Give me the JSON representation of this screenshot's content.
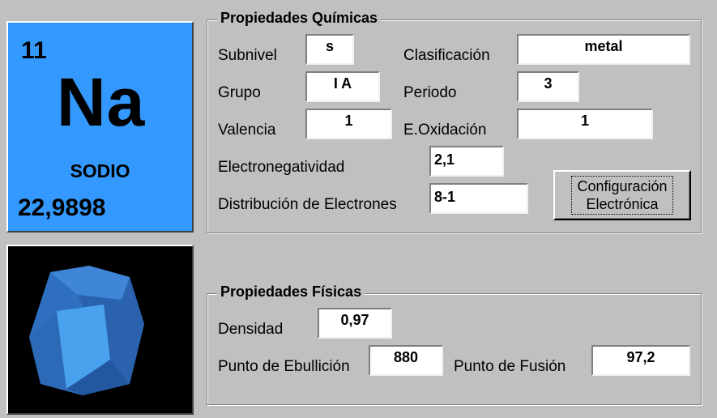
{
  "element": {
    "atomic_number": "11",
    "symbol": "Na",
    "name": "SODIO",
    "atomic_mass": "22,9898",
    "card_color": "#3399ff"
  },
  "image": {
    "name": "crystal-image",
    "color": "#3399ff"
  },
  "quimicas": {
    "title": "Propiedades Químicas",
    "subnivel": {
      "label": "Subnivel",
      "value": "s"
    },
    "clasificacion": {
      "label": "Clasificación",
      "value": "metal"
    },
    "grupo": {
      "label": "Grupo",
      "value": "I A"
    },
    "periodo": {
      "label": "Periodo",
      "value": "3"
    },
    "valencia": {
      "label": "Valencia",
      "value": "1"
    },
    "oxidacion": {
      "label": "E.Oxidación",
      "value": "1"
    },
    "electronegatividad": {
      "label": "Electronegatividad",
      "value": "2,1"
    },
    "distribucion": {
      "label": "Distribución de  Electrones",
      "value": "8-1"
    },
    "config_button": {
      "line1": "Configuración",
      "line2": "Electrónica"
    }
  },
  "fisicas": {
    "title": "Propiedades Físicas",
    "densidad": {
      "label": "Densidad",
      "value": "0,97"
    },
    "ebullicion": {
      "label": "Punto de Ebullición",
      "value": "880"
    },
    "fusion": {
      "label": "Punto de Fusión",
      "value": "97,2"
    }
  }
}
